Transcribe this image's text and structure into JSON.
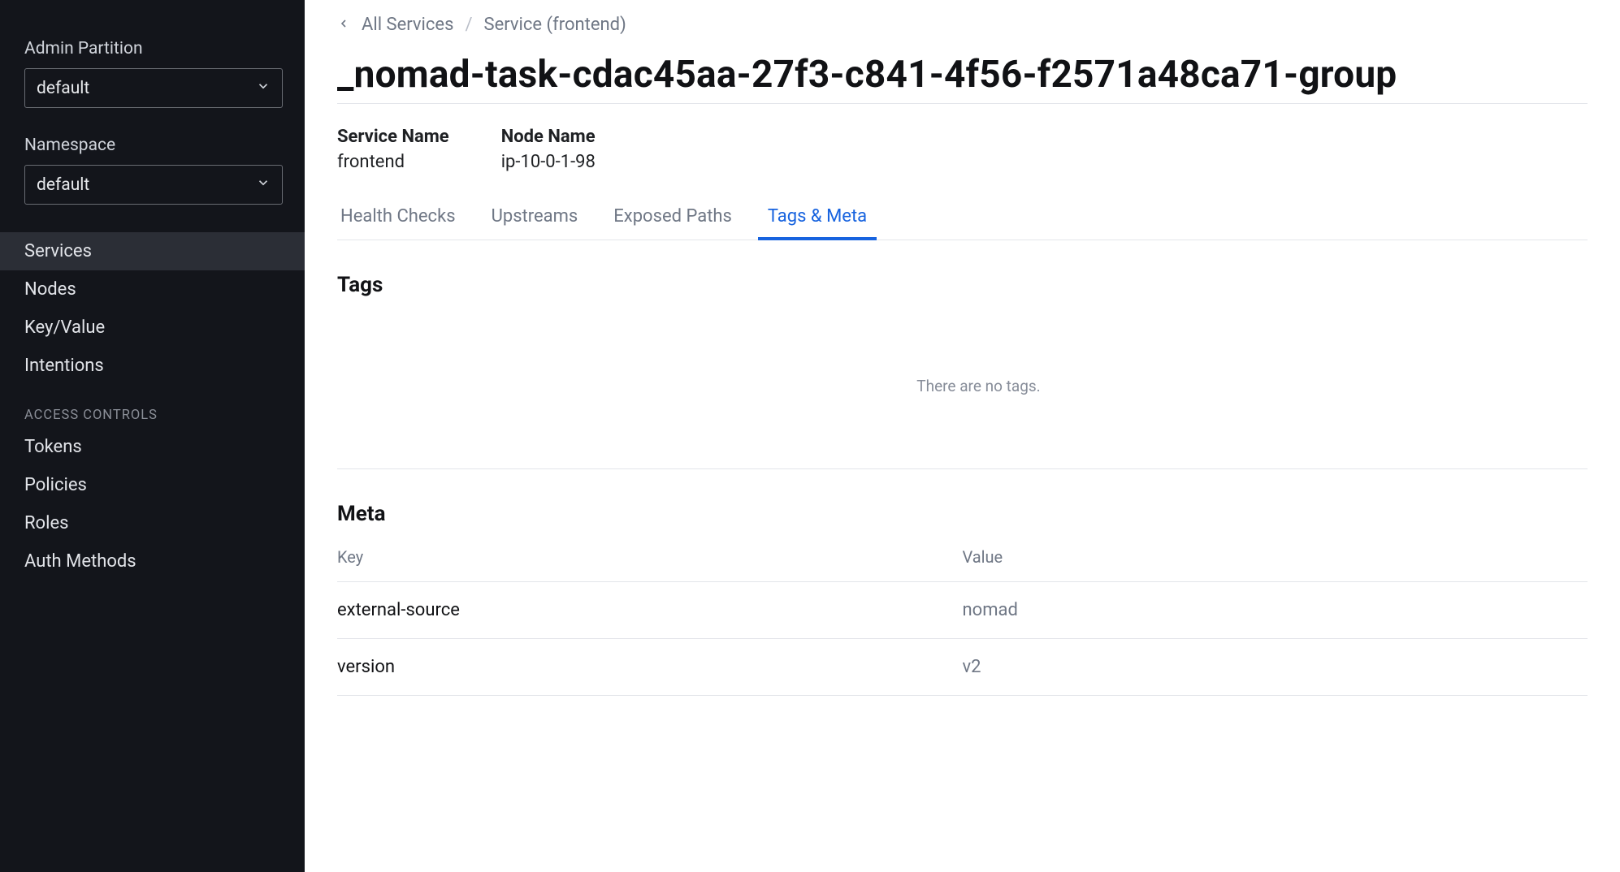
{
  "sidebar": {
    "admin_partition_label": "Admin Partition",
    "admin_partition_value": "default",
    "namespace_label": "Namespace",
    "namespace_value": "default",
    "nav": [
      {
        "label": "Services",
        "slug": "services",
        "active": true
      },
      {
        "label": "Nodes",
        "slug": "nodes",
        "active": false
      },
      {
        "label": "Key/Value",
        "slug": "key-value",
        "active": false
      },
      {
        "label": "Intentions",
        "slug": "intentions",
        "active": false
      }
    ],
    "access_controls_heading": "ACCESS CONTROLS",
    "access_nav": [
      {
        "label": "Tokens",
        "slug": "tokens"
      },
      {
        "label": "Policies",
        "slug": "policies"
      },
      {
        "label": "Roles",
        "slug": "roles"
      },
      {
        "label": "Auth Methods",
        "slug": "auth-methods"
      }
    ]
  },
  "breadcrumb": {
    "all_services": "All Services",
    "current": "Service (frontend)"
  },
  "page_title": "_nomad-task-cdac45aa-27f3-c841-4f56-f2571a48ca71-group",
  "info": {
    "service_name_label": "Service Name",
    "service_name_value": "frontend",
    "node_name_label": "Node Name",
    "node_name_value": "ip-10-0-1-98"
  },
  "tabs": [
    {
      "label": "Health Checks",
      "slug": "health-checks",
      "active": false
    },
    {
      "label": "Upstreams",
      "slug": "upstreams",
      "active": false
    },
    {
      "label": "Exposed Paths",
      "slug": "exposed-paths",
      "active": false
    },
    {
      "label": "Tags & Meta",
      "slug": "tags-meta",
      "active": true
    }
  ],
  "tags_section": {
    "title": "Tags",
    "empty_message": "There are no tags."
  },
  "meta_section": {
    "title": "Meta",
    "columns": {
      "key": "Key",
      "value": "Value"
    },
    "rows": [
      {
        "key": "external-source",
        "value": "nomad"
      },
      {
        "key": "version",
        "value": "v2"
      }
    ]
  }
}
